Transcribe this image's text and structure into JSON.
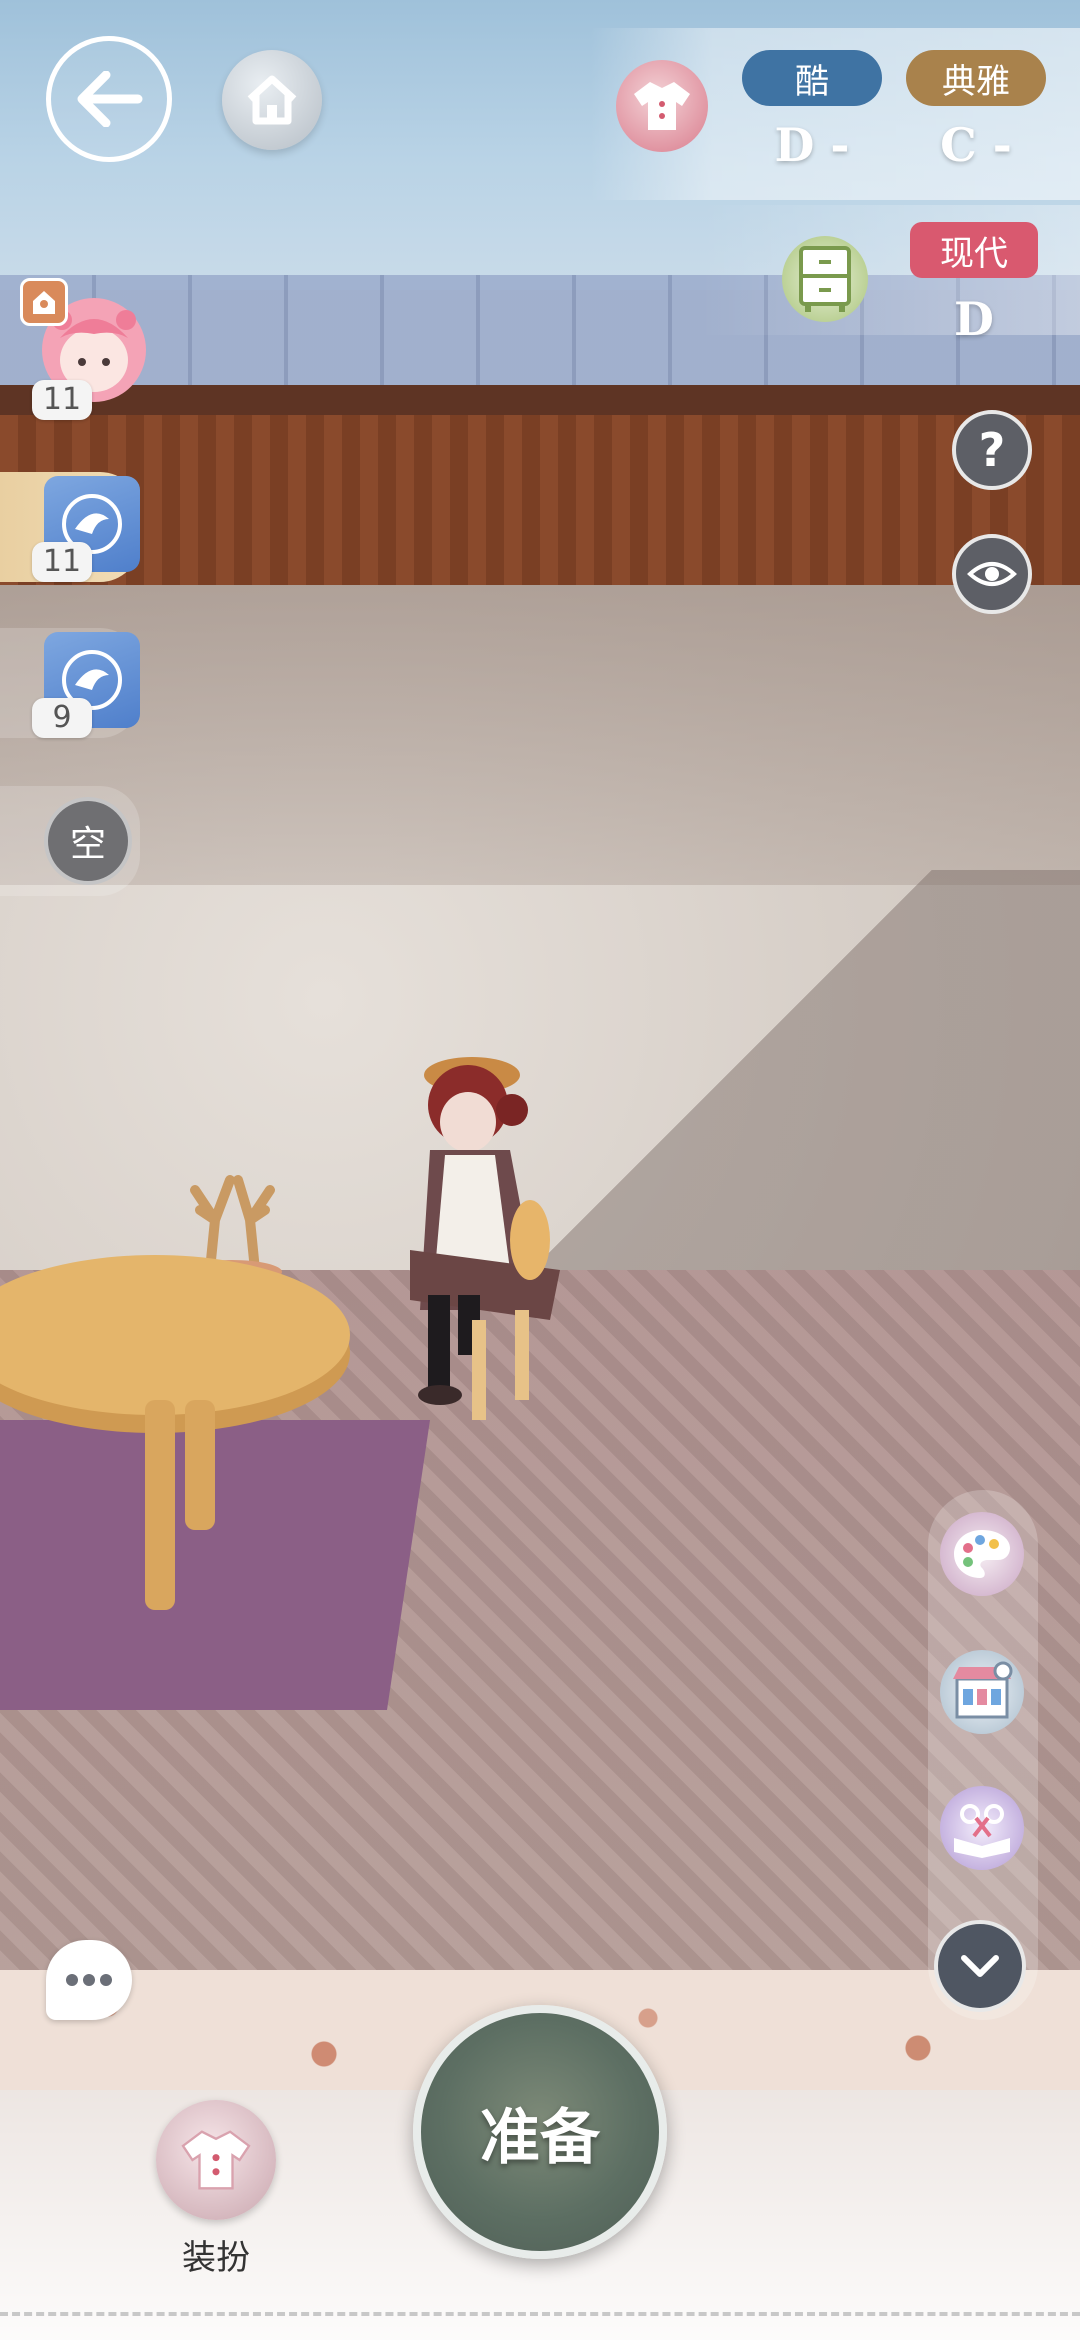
{
  "top_bar": {
    "back_icon": "arrow-left-icon",
    "home_icon": "house-icon"
  },
  "ratings": {
    "clothing_icon": "shirt-icon",
    "furniture_icon": "cabinet-icon",
    "items": [
      {
        "label": "酷",
        "grade": "D -",
        "color": "#3f73a3"
      },
      {
        "label": "典雅",
        "grade": "C -",
        "color": "#a9824c"
      },
      {
        "label": "现代",
        "grade": "D",
        "color": "#d9596f"
      }
    ]
  },
  "side_slots": [
    {
      "count": "11",
      "type": "avatar"
    },
    {
      "count": "11",
      "type": "fish-emblem"
    },
    {
      "count": "9",
      "type": "fish-emblem"
    },
    {
      "label": "空",
      "type": "empty"
    }
  ],
  "right_buttons": {
    "help": "?",
    "eye_icon": "eye-icon"
  },
  "tools": [
    "palette-icon",
    "shop-icon",
    "scissors-book-icon",
    "chevron-down-icon"
  ],
  "bottom": {
    "chat_icon": "chat-bubble-icon",
    "ready_label": "准备",
    "dress_label": "装扮"
  }
}
